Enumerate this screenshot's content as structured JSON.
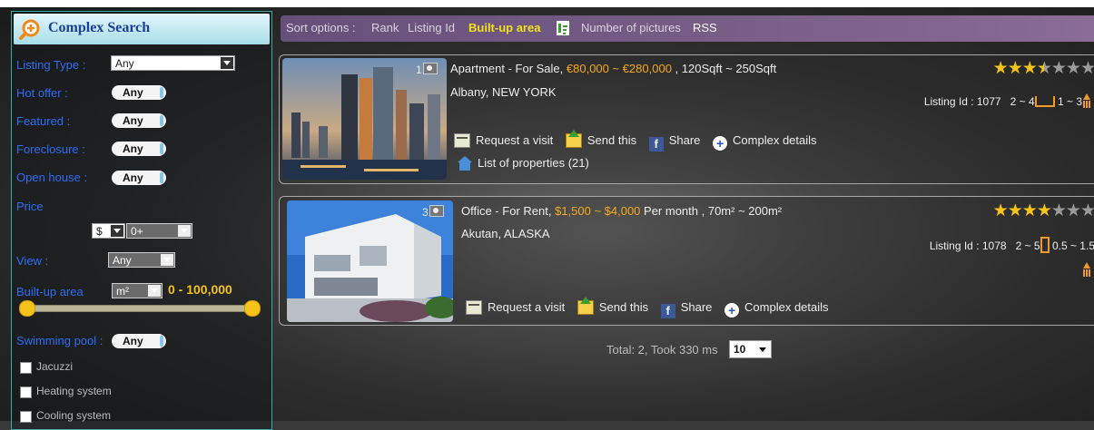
{
  "sidebar": {
    "title": "Complex Search",
    "listing_type_label": "Listing Type :",
    "listing_type_value": "Any",
    "hot_offer_label": "Hot offer :",
    "hot_offer_value": "Any",
    "featured_label": "Featured :",
    "featured_value": "Any",
    "foreclosure_label": "Foreclosure :",
    "foreclosure_value": "Any",
    "open_house_label": "Open house :",
    "open_house_value": "Any",
    "price_label": "Price",
    "currency_value": "$",
    "price_value": "0+",
    "view_label": "View :",
    "view_value": "Any",
    "builtup_label": "Built-up area",
    "builtup_unit": "m²",
    "builtup_range": "0 - 100,000",
    "swimming_label": "Swimming pool :",
    "swimming_value": "Any",
    "checkboxes": [
      "Jacuzzi",
      "Heating system",
      "Cooling system"
    ]
  },
  "sortbar": {
    "label": "Sort options :",
    "rank": "Rank",
    "listing_id": "Listing Id",
    "builtup": "Built-up area",
    "pictures": "Number of pictures",
    "rss": "RSS"
  },
  "listings": [
    {
      "pic_count": "1",
      "type": "Apartment - For Sale, ",
      "price": "€80,000 ~ €280,000",
      "area": " , 120Sqft ~ 250Sqft",
      "location": "Albany, NEW YORK",
      "rating": 3.5,
      "id_label": "Listing Id : 1077",
      "rooms": "2 ~ 4",
      "baths": "1 ~ 3",
      "actions": {
        "visit": "Request a visit",
        "send": "Send this",
        "share": "Share",
        "details": "Complex details"
      },
      "properties": "List of properties (21)"
    },
    {
      "pic_count": "3",
      "type": "Office - For Rent, ",
      "price": "$1,500 ~ $4,000",
      "area": " Per month , 70m² ~ 200m²",
      "location": "Akutan, ALASKA",
      "rating": 4,
      "id_label": "Listing Id : 1078",
      "rooms": "2 ~ 5",
      "baths": "0.5 ~ 1.5",
      "actions": {
        "visit": "Request a visit",
        "send": "Send this",
        "share": "Share",
        "details": "Complex details"
      }
    }
  ],
  "footer": {
    "total": "Total: 2, Took 330 ms",
    "page_size": "10"
  }
}
